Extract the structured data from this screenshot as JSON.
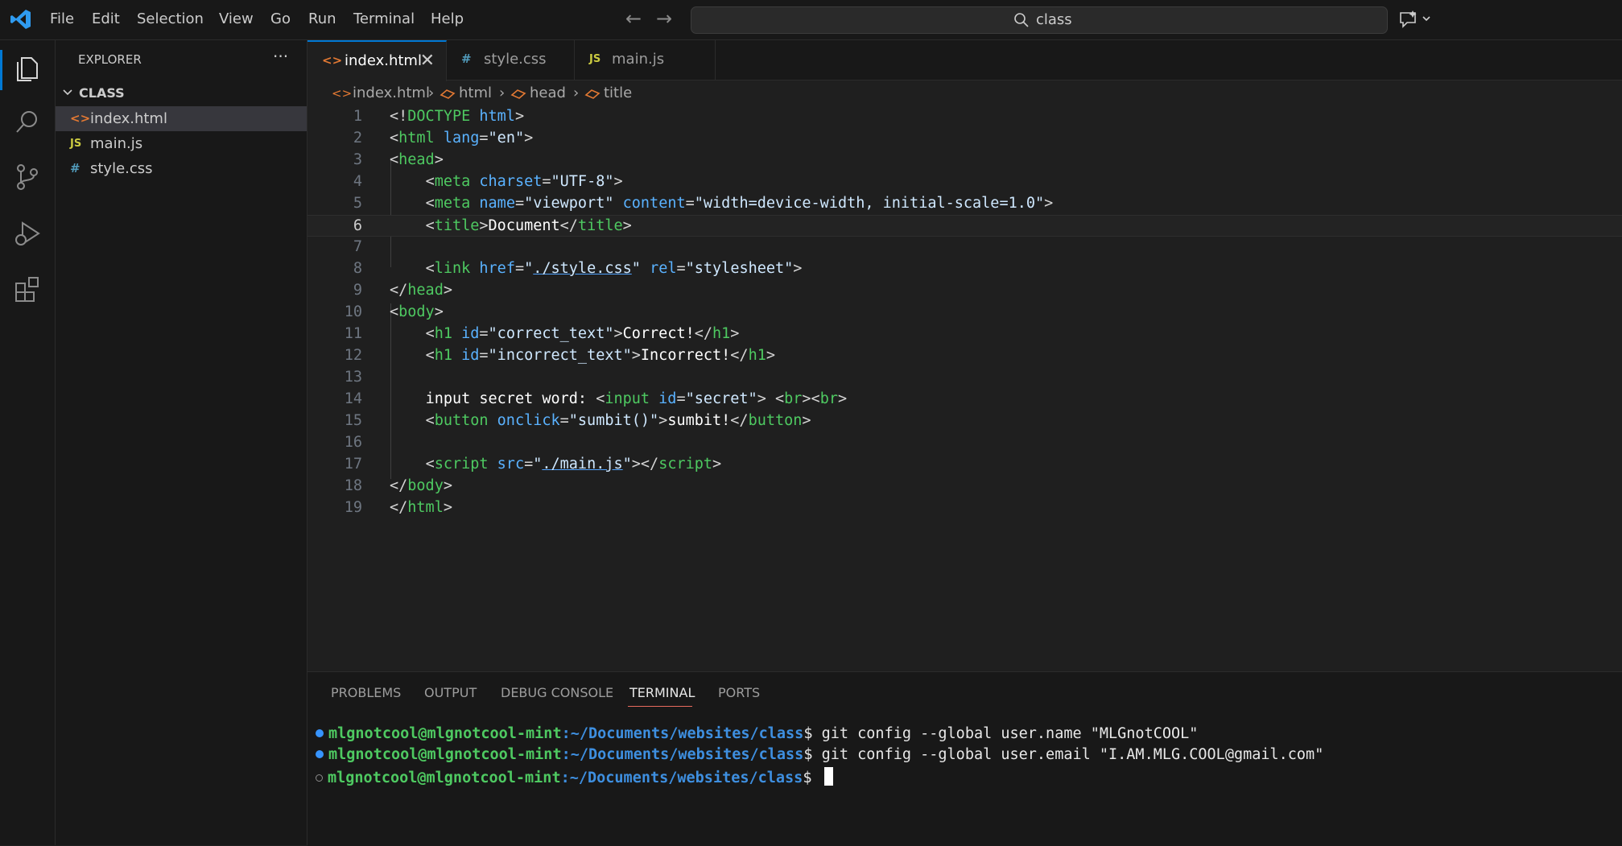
{
  "menu": [
    "File",
    "Edit",
    "Selection",
    "View",
    "Go",
    "Run",
    "Terminal",
    "Help"
  ],
  "search": {
    "text": "class"
  },
  "sidebar": {
    "title": "EXPLORER",
    "more": "···",
    "folder": "CLASS",
    "files": [
      {
        "name": "index.html",
        "icon": "<>",
        "icon_color": "#e37933",
        "selected": true
      },
      {
        "name": "main.js",
        "icon": "JS",
        "icon_color": "#cbcb41",
        "selected": false
      },
      {
        "name": "style.css",
        "icon": "#",
        "icon_color": "#519aba",
        "selected": false
      }
    ]
  },
  "tabs": [
    {
      "label": "index.html",
      "icon": "<>",
      "icon_color": "#e37933",
      "active": true,
      "close": "✕"
    },
    {
      "label": "style.css",
      "icon": "#",
      "icon_color": "#519aba",
      "active": false
    },
    {
      "label": "main.js",
      "icon": "JS",
      "icon_color": "#cbcb41",
      "active": false
    }
  ],
  "breadcrumb": [
    "index.html",
    "html",
    "head",
    "title"
  ],
  "code": {
    "line_numbers": [
      "1",
      "2",
      "3",
      "4",
      "5",
      "6",
      "7",
      "8",
      "9",
      "10",
      "11",
      "12",
      "13",
      "14",
      "15",
      "16",
      "17",
      "18",
      "19"
    ],
    "current_line": 6
  },
  "panel": {
    "tabs": [
      "PROBLEMS",
      "OUTPUT",
      "DEBUG CONSOLE",
      "TERMINAL",
      "PORTS"
    ],
    "active_tab": "TERMINAL",
    "terminal": [
      {
        "user": "mlgnotcool@mlgnotcool-mint",
        "path": ":~/Documents/websites/class",
        "prompt": "$ ",
        "cmd": "git config --global user.name \"MLGnotCOOL\"",
        "dot": "filled"
      },
      {
        "user": "mlgnotcool@mlgnotcool-mint",
        "path": ":~/Documents/websites/class",
        "prompt": "$ ",
        "cmd": "git config --global user.email \"I.AM.MLG.COOL@gmail.com\"",
        "dot": "filled"
      },
      {
        "user": "mlgnotcool@mlgnotcool-mint",
        "path": ":~/Documents/websites/class",
        "prompt": "$ ",
        "cmd": "",
        "dot": "hollow"
      }
    ]
  },
  "colors": {
    "accent": "#0078d4",
    "tag": "#4ec961",
    "attribute": "#5ab2ff",
    "terminal_dot": "#3794ff"
  }
}
